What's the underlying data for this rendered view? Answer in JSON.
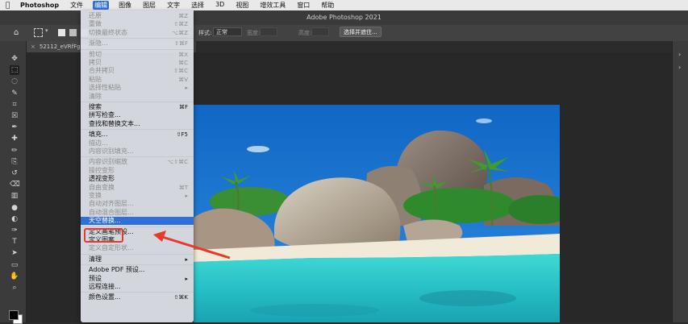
{
  "menubar": {
    "app": "Photoshop",
    "items": [
      "文件",
      "编辑",
      "图像",
      "图层",
      "文字",
      "选择",
      "3D",
      "视图",
      "增效工具",
      "窗口",
      "帮助"
    ],
    "active_index": 1
  },
  "window": {
    "title": "Adobe Photoshop 2021"
  },
  "options_bar": {
    "style_label": "样式:",
    "style_value": "正常",
    "width_label": "宽度:",
    "height_label": "高度:",
    "select_mask_button": "选择并遮住..."
  },
  "doc_tab": {
    "title": "52112_eVRfFgnV"
  },
  "edit_menu": {
    "items": [
      {
        "label": "还原",
        "shortcut": "⌘Z",
        "disabled": true
      },
      {
        "label": "重做",
        "shortcut": "⇧⌘Z",
        "disabled": true
      },
      {
        "label": "切换最终状态",
        "shortcut": "⌥⌘Z",
        "disabled": true
      },
      {
        "sep": true
      },
      {
        "label": "渐隐...",
        "shortcut": "⇧⌘F",
        "disabled": true
      },
      {
        "sep": true
      },
      {
        "label": "剪切",
        "shortcut": "⌘X",
        "disabled": true
      },
      {
        "label": "拷贝",
        "shortcut": "⌘C",
        "disabled": true
      },
      {
        "label": "合并拷贝",
        "shortcut": "⇧⌘C",
        "disabled": true
      },
      {
        "label": "粘贴",
        "shortcut": "⌘V",
        "disabled": true
      },
      {
        "label": "选择性粘贴",
        "shortcut": "▸",
        "disabled": true
      },
      {
        "label": "清除",
        "shortcut": "",
        "disabled": true
      },
      {
        "sep": true
      },
      {
        "label": "搜索",
        "shortcut": "⌘F",
        "disabled": false
      },
      {
        "label": "拼写检查...",
        "shortcut": "",
        "disabled": false
      },
      {
        "label": "查找和替换文本...",
        "shortcut": "",
        "disabled": false
      },
      {
        "sep": true
      },
      {
        "label": "填充...",
        "shortcut": "⇧F5",
        "disabled": false
      },
      {
        "label": "描边...",
        "shortcut": "",
        "disabled": true
      },
      {
        "label": "内容识别填充...",
        "shortcut": "",
        "disabled": true
      },
      {
        "sep": true
      },
      {
        "label": "内容识别缩放",
        "shortcut": "⌥⇧⌘C",
        "disabled": true
      },
      {
        "label": "操控变形",
        "shortcut": "",
        "disabled": true
      },
      {
        "label": "透视变形",
        "shortcut": "",
        "disabled": false
      },
      {
        "label": "自由变换",
        "shortcut": "⌘T",
        "disabled": true
      },
      {
        "label": "变换",
        "shortcut": "▸",
        "disabled": true
      },
      {
        "label": "自动对齐图层...",
        "shortcut": "",
        "disabled": true
      },
      {
        "label": "自动混合图层...",
        "shortcut": "",
        "disabled": true
      },
      {
        "label": "天空替换...",
        "shortcut": "",
        "disabled": false,
        "highlighted": true
      },
      {
        "sep": true
      },
      {
        "label": "定义画笔预设...",
        "shortcut": "",
        "disabled": false
      },
      {
        "label": "定义图案...",
        "shortcut": "",
        "disabled": false
      },
      {
        "label": "定义自定形状...",
        "shortcut": "",
        "disabled": true
      },
      {
        "sep": true
      },
      {
        "label": "清理",
        "shortcut": "▸",
        "disabled": false
      },
      {
        "sep": true
      },
      {
        "label": "Adobe PDF 预设...",
        "shortcut": "",
        "disabled": false
      },
      {
        "label": "预设",
        "shortcut": "▸",
        "disabled": false
      },
      {
        "label": "远程连接...",
        "shortcut": "",
        "disabled": false
      },
      {
        "sep": true
      },
      {
        "label": "颜色设置...",
        "shortcut": "⇧⌘K",
        "disabled": false
      }
    ]
  },
  "toolbar": {
    "tools": [
      "move-icon",
      "marquee-icon",
      "lasso-icon",
      "quick-select-icon",
      "crop-icon",
      "frame-icon",
      "eyedropper-icon",
      "healing-icon",
      "brush-icon",
      "stamp-icon",
      "history-brush-icon",
      "eraser-icon",
      "gradient-icon",
      "blur-icon",
      "dodge-icon",
      "pen-icon",
      "type-icon",
      "path-select-icon",
      "rectangle-icon",
      "hand-icon",
      "zoom-icon"
    ],
    "selected_index": 1
  },
  "colors": {
    "accent": "#2f6fd6",
    "highlight_red": "#e53a2c"
  }
}
